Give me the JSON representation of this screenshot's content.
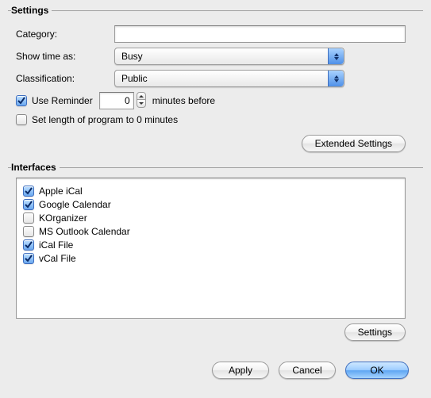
{
  "settings": {
    "legend": "Settings",
    "category_label": "Category:",
    "category_value": "",
    "showtime_label": "Show time as:",
    "showtime_value": "Busy",
    "classification_label": "Classification:",
    "classification_value": "Public",
    "use_reminder_label": "Use Reminder",
    "use_reminder_checked": true,
    "reminder_value": "0",
    "reminder_suffix": "minutes before",
    "set_length_label": "Set length of program to 0 minutes",
    "set_length_checked": false,
    "extended_button": "Extended Settings"
  },
  "interfaces": {
    "legend": "Interfaces",
    "items": [
      {
        "label": "Apple iCal",
        "checked": true
      },
      {
        "label": "Google Calendar",
        "checked": true
      },
      {
        "label": "KOrganizer",
        "checked": false
      },
      {
        "label": "MS Outlook Calendar",
        "checked": false
      },
      {
        "label": "iCal File",
        "checked": true
      },
      {
        "label": "vCal File",
        "checked": true
      }
    ],
    "settings_button": "Settings"
  },
  "buttons": {
    "apply": "Apply",
    "cancel": "Cancel",
    "ok": "OK"
  }
}
